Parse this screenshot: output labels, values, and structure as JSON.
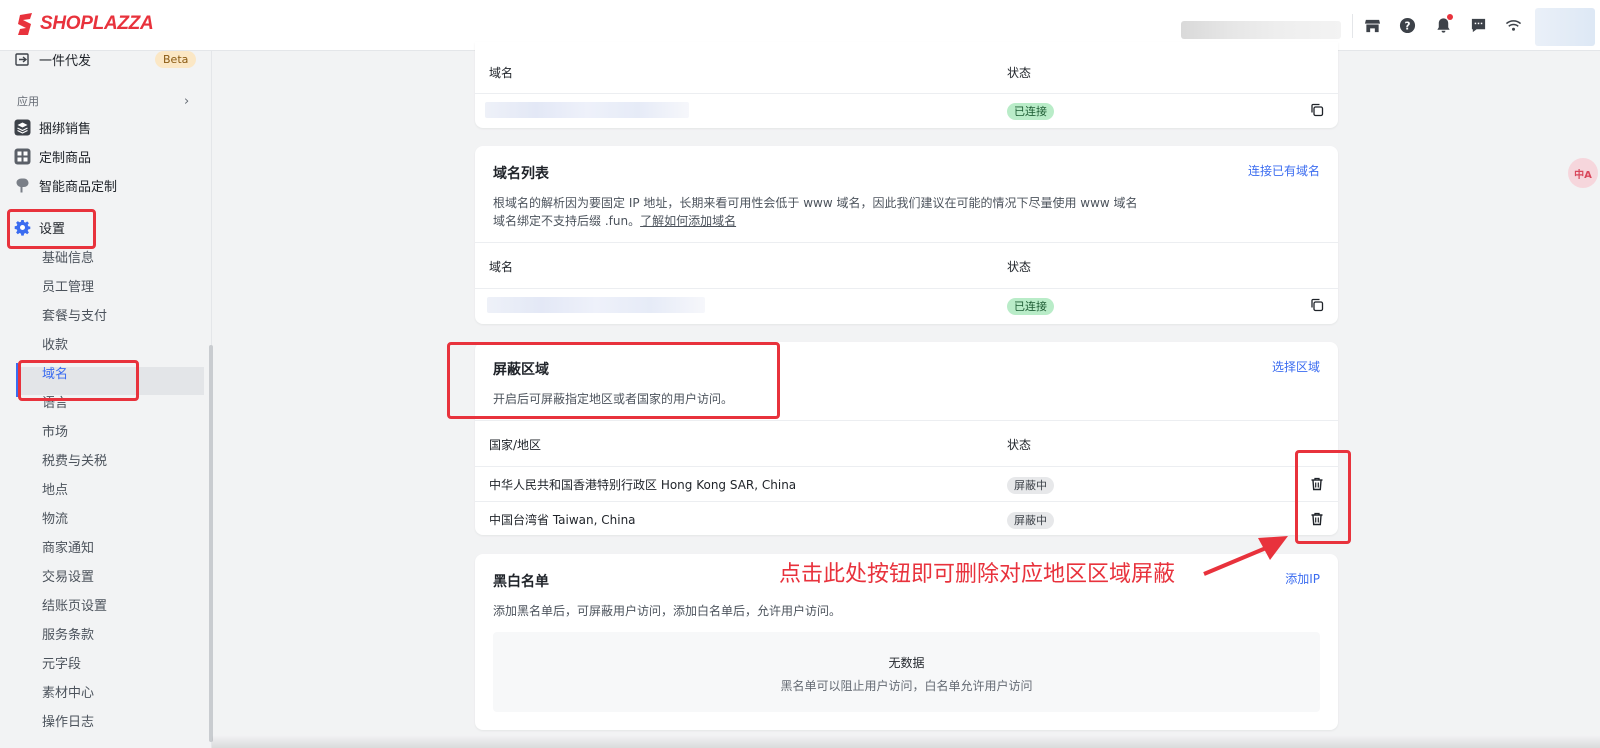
{
  "brand": {
    "name": "SHOPLAZZA",
    "color": "#e8323c"
  },
  "header": {
    "icons": [
      "store-icon",
      "help-icon",
      "bell-icon",
      "message-icon",
      "wifi-icon"
    ]
  },
  "sidebar": {
    "top_item": {
      "label": "一件代发",
      "badge": "Beta"
    },
    "apps_group": {
      "label": "应用"
    },
    "apps": [
      {
        "label": "捆绑销售",
        "icon": "layers-icon"
      },
      {
        "label": "定制商品",
        "icon": "customize-icon"
      },
      {
        "label": "智能商品定制",
        "icon": "brush-icon"
      }
    ],
    "settings": {
      "label": "设置",
      "icon": "gear-icon"
    },
    "settings_items": [
      "基础信息",
      "员工管理",
      "套餐与支付",
      "收款",
      "域名",
      "语言",
      "市场",
      "税费与关税",
      "地点",
      "物流",
      "商家通知",
      "交易设置",
      "结账页设置",
      "服务条款",
      "元字段",
      "素材中心",
      "操作日志"
    ],
    "active_item": "域名"
  },
  "card_primary": {
    "columns": [
      "域名",
      "状态"
    ],
    "row": {
      "status": "已连接"
    }
  },
  "card_domain_list": {
    "title": "域名列表",
    "link": "连接已有域名",
    "desc_line1": "根域名的解析因为要固定 IP 地址，长期来看可用性会低于 www 域名，因此我们建议在可能的情况下尽量使用 www 域名",
    "desc_line2_prefix": "域名绑定不支持后缀 .fun。",
    "desc_line2_link": "了解如何添加域名",
    "columns": [
      "域名",
      "状态"
    ],
    "row": {
      "status": "已连接"
    }
  },
  "card_block_region": {
    "title": "屏蔽区域",
    "link": "选择区域",
    "desc": "开启后可屏蔽指定地区或者国家的用户访问。",
    "columns": [
      "国家/地区",
      "状态"
    ],
    "rows": [
      {
        "region": "中华人民共和国香港特别行政区 Hong Kong SAR, China",
        "status": "屏蔽中"
      },
      {
        "region": "中国台湾省 Taiwan, China",
        "status": "屏蔽中"
      }
    ]
  },
  "card_blacklist": {
    "title": "黑白名单",
    "link": "添加IP",
    "desc": "添加黑名单后，可屏蔽用户访问，添加白名单后，允许用户访问。",
    "empty_title": "无数据",
    "empty_desc": "黑名单可以阻止用户访问，白名单允许用户访问"
  },
  "annotation": {
    "text": "点击此处按钮即可删除对应地区区域屏蔽",
    "color": "#e8323c"
  },
  "floating": {
    "label": "中A"
  }
}
